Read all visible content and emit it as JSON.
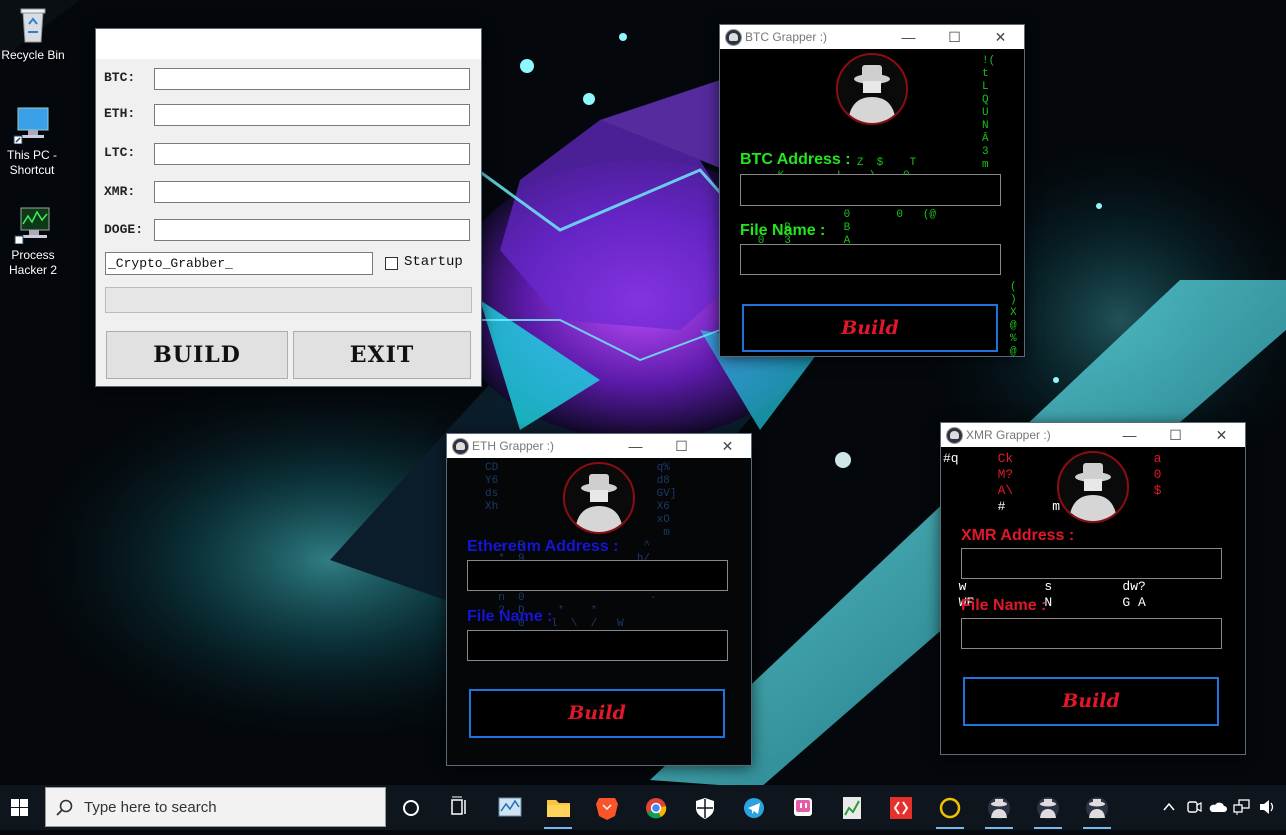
{
  "desktop": {
    "icons": [
      {
        "label": "Recycle Bin"
      },
      {
        "label": "This PC - Shortcut"
      },
      {
        "label": "Process Hacker 2"
      }
    ]
  },
  "builder": {
    "fields": [
      {
        "label": "BTC:",
        "value": ""
      },
      {
        "label": "ETH:",
        "value": ""
      },
      {
        "label": "LTC:",
        "value": ""
      },
      {
        "label": "XMR:",
        "value": ""
      },
      {
        "label": "DOGE:",
        "value": ""
      }
    ],
    "filename": "_Crypto_Grabber_",
    "startup_label": "Startup",
    "startup_checked": false,
    "build_label": "BUILD",
    "exit_label": "EXIT"
  },
  "btc_window": {
    "title": "BTC Grapper :)",
    "address_label": "BTC Address :",
    "filename_label": "File Name :",
    "build_label": "Build",
    "accent": "#22e61e"
  },
  "eth_window": {
    "title": "ETH Grapper :)",
    "address_label": "Ethereum Address :",
    "filename_label": "File Name :",
    "build_label": "Build",
    "accent": "#1515d6"
  },
  "xmr_window": {
    "title": "XMR Grapper :)",
    "address_label": "XMR Address :",
    "filename_label": "File Name :",
    "build_label": "Build",
    "accent": "#e0182a"
  },
  "window_controls": {
    "minimize": "—",
    "maximize": "☐",
    "close": "✕"
  },
  "taskbar": {
    "search_placeholder": "Type here to search",
    "apps": [
      "task-view",
      "resource-monitor",
      "file-explorer",
      "brave",
      "chrome",
      "security",
      "telegram",
      "twitch",
      "notepad-chart",
      "anydesk",
      "spinner-app",
      "grapper-1",
      "grapper-2",
      "grapper-3"
    ]
  }
}
